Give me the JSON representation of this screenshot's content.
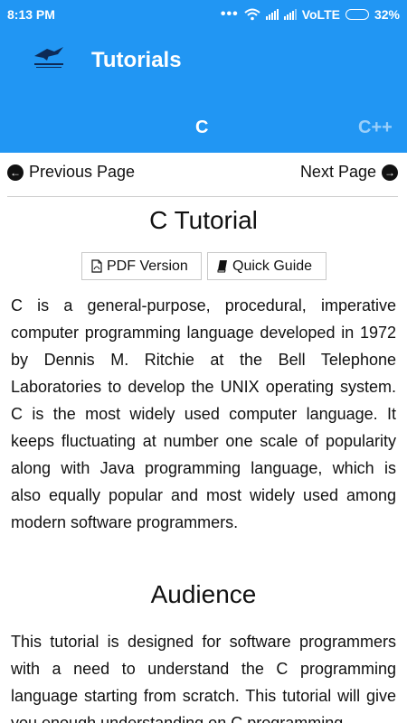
{
  "status_bar": {
    "time": "8:13 PM",
    "network": "VoLTE",
    "battery": "32%",
    "battery_level": 0.32
  },
  "header": {
    "title": "Tutorials",
    "tabs": [
      {
        "label": "C"
      },
      {
        "label": "C++"
      }
    ],
    "colors": {
      "header_bg": "#2196f3"
    }
  },
  "pager": {
    "previous": "Previous Page",
    "next": "Next Page"
  },
  "main": {
    "title": "C Tutorial",
    "pdf_button": "PDF Version",
    "quick_guide_button": "Quick Guide",
    "intro": "C is a general-purpose, procedural, imperative computer programming language developed in 1972 by Dennis M. Ritchie at the Bell Telephone Laboratories to develop the UNIX operating system. C is the most widely used computer language. It keeps fluctuating at number one scale of popularity along with Java programming language, which is also equally popular and most widely used among modern software programmers.",
    "audience_title": "Audience",
    "audience_text": "This tutorial is designed for software programmers with a need to understand the C programming language starting from scratch. This tutorial will give you enough understanding on C programming"
  }
}
